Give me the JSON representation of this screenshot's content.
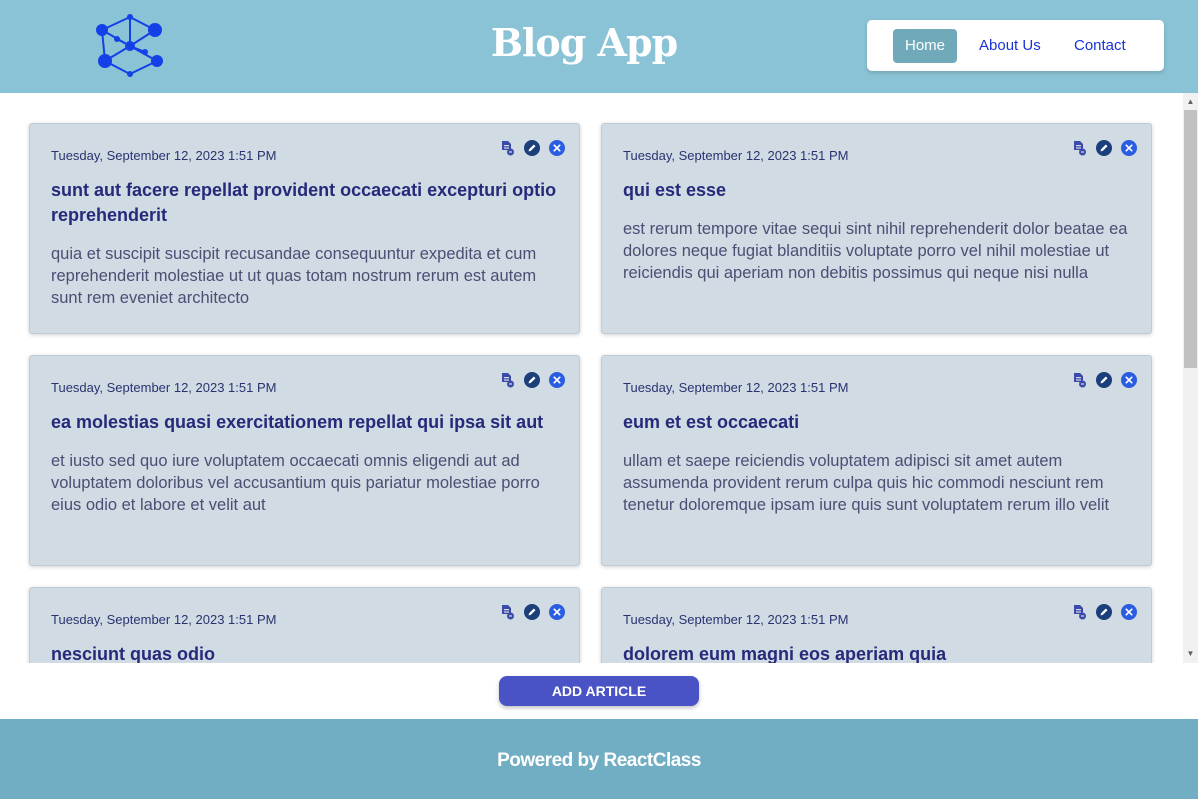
{
  "header": {
    "title": "Blog App",
    "nav": [
      {
        "label": "Home",
        "active": true
      },
      {
        "label": "About Us",
        "active": false
      },
      {
        "label": "Contact",
        "active": false
      }
    ]
  },
  "colors": {
    "header_bg": "#8ac3d5",
    "card_bg": "#d0dbe3",
    "accent": "#4a53c6",
    "footer_bg": "#71aec4"
  },
  "cards": [
    {
      "date": "Tuesday, September 12, 2023 1:51 PM",
      "title": "sunt aut facere repellat provident occaecati excepturi optio reprehenderit",
      "body": "quia et suscipit suscipit recusandae consequuntur expedita et cum reprehenderit molestiae ut ut quas totam nostrum rerum est autem sunt rem eveniet architecto"
    },
    {
      "date": "Tuesday, September 12, 2023 1:51 PM",
      "title": "qui est esse",
      "body": "est rerum tempore vitae sequi sint nihil reprehenderit dolor beatae ea dolores neque fugiat blanditiis voluptate porro vel nihil molestiae ut reiciendis qui aperiam non debitis possimus qui neque nisi nulla"
    },
    {
      "date": "Tuesday, September 12, 2023 1:51 PM",
      "title": "ea molestias quasi exercitationem repellat qui ipsa sit aut",
      "body": "et iusto sed quo iure voluptatem occaecati omnis eligendi aut ad voluptatem doloribus vel accusantium quis pariatur molestiae porro eius odio et labore et velit aut"
    },
    {
      "date": "Tuesday, September 12, 2023 1:51 PM",
      "title": "eum et est occaecati",
      "body": "ullam et saepe reiciendis voluptatem adipisci sit amet autem assumenda provident rerum culpa quis hic commodi nesciunt rem tenetur doloremque ipsam iure quis sunt voluptatem rerum illo velit"
    },
    {
      "date": "Tuesday, September 12, 2023 1:51 PM",
      "title": "nesciunt quas odio",
      "body": ""
    },
    {
      "date": "Tuesday, September 12, 2023 1:51 PM",
      "title": "dolorem eum magni eos aperiam quia",
      "body": ""
    }
  ],
  "card_action_icons": [
    "details-icon",
    "edit-icon",
    "delete-icon"
  ],
  "add_button_label": "ADD ARTICLE",
  "footer_text": "Powered by ReactClass"
}
